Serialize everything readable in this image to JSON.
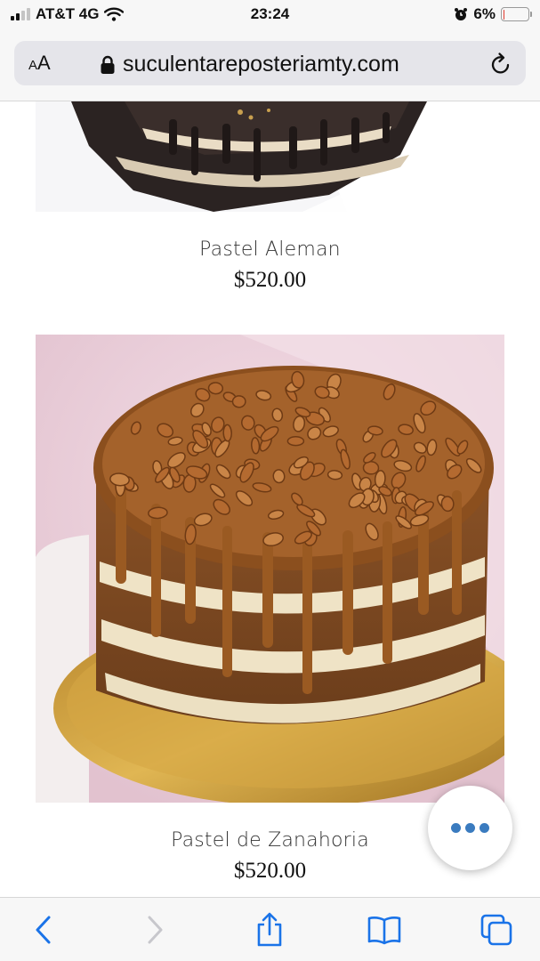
{
  "status_bar": {
    "carrier": "AT&T 4G",
    "time": "23:24",
    "battery_percent": "6%",
    "battery_level": 0.06,
    "icons": [
      "signal-icon",
      "wifi-icon",
      "alarm-icon",
      "battery-icon"
    ]
  },
  "browser": {
    "text_size_label_small": "A",
    "text_size_label_large": "A",
    "url": "suculentareposteriamty.com",
    "icons": [
      "lock-icon",
      "reload-icon"
    ]
  },
  "products": [
    {
      "name": "Pastel Aleman",
      "price": "$520.00"
    },
    {
      "name": "Pastel de Zanahoria",
      "price": "$520.00"
    }
  ],
  "fab": {
    "icon": "more-dots-icon",
    "color": "#3a7bbf"
  },
  "toolbar": {
    "icons": [
      "back-icon",
      "forward-icon",
      "share-icon",
      "bookmarks-icon",
      "tabs-icon"
    ],
    "accent": "#1a73e8"
  }
}
